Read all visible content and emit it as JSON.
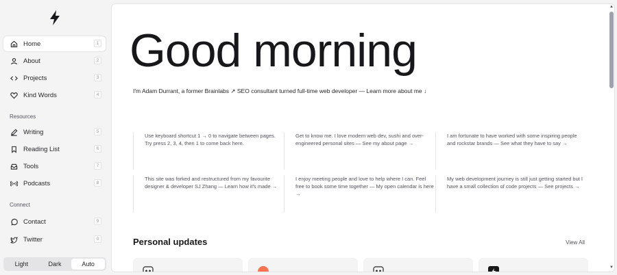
{
  "sidebar": {
    "logo": "lightning-bolt-icon",
    "items": [
      {
        "label": "Home",
        "key": "1",
        "icon": "home-icon"
      },
      {
        "label": "About",
        "key": "2",
        "icon": "user-icon"
      },
      {
        "label": "Projects",
        "key": "3",
        "icon": "code-icon"
      },
      {
        "label": "Kind Words",
        "key": "4",
        "icon": "heart-icon"
      }
    ],
    "resources_label": "Resources",
    "resources": [
      {
        "label": "Writing",
        "key": "5",
        "icon": "pen-icon"
      },
      {
        "label": "Reading List",
        "key": "6",
        "icon": "bookmark-icon"
      },
      {
        "label": "Tools",
        "key": "7",
        "icon": "inbox-icon"
      },
      {
        "label": "Podcasts",
        "key": "8",
        "icon": "broadcast-icon"
      }
    ],
    "connect_label": "Connect",
    "connect": [
      {
        "label": "Contact",
        "key": "9",
        "icon": "chat-bubble-icon"
      },
      {
        "label": "Twitter",
        "key": "0",
        "icon": "twitter-icon"
      }
    ],
    "theme": {
      "light": "Light",
      "dark": "Dark",
      "auto": "Auto",
      "selected": "Auto"
    }
  },
  "main": {
    "heading": "Good morning",
    "intro": "I'm Adam Durrant, a former Brainlabs ↗ SEO consultant turned full-time web developer — Learn more about me ↓",
    "tips": [
      "Use keyboard shortcut 1 → 0 to navigate between pages. Try press 2, 3, 4, then 1 to come back here.",
      "Get to know me. I love modern web dev, sushi and over-engineered personal sites — See my about page →",
      "I am fortunate to have worked with some inspiring people and rockstar brands — See what they have to say →",
      "This site was forked and restructured from my favourite designer & developer SJ Zhang — Learn how it's made →",
      "I enjoy meeting people and love to help where I can. Feel free to book some time together — My open calendar is here →",
      "My web development journey is still just getting started but I have a small collection of code projects — See projects →"
    ],
    "updates_title": "Personal updates",
    "view_all": "View All"
  },
  "colors": {
    "accent_card": "#f97352",
    "dark_card": "#18181b"
  }
}
